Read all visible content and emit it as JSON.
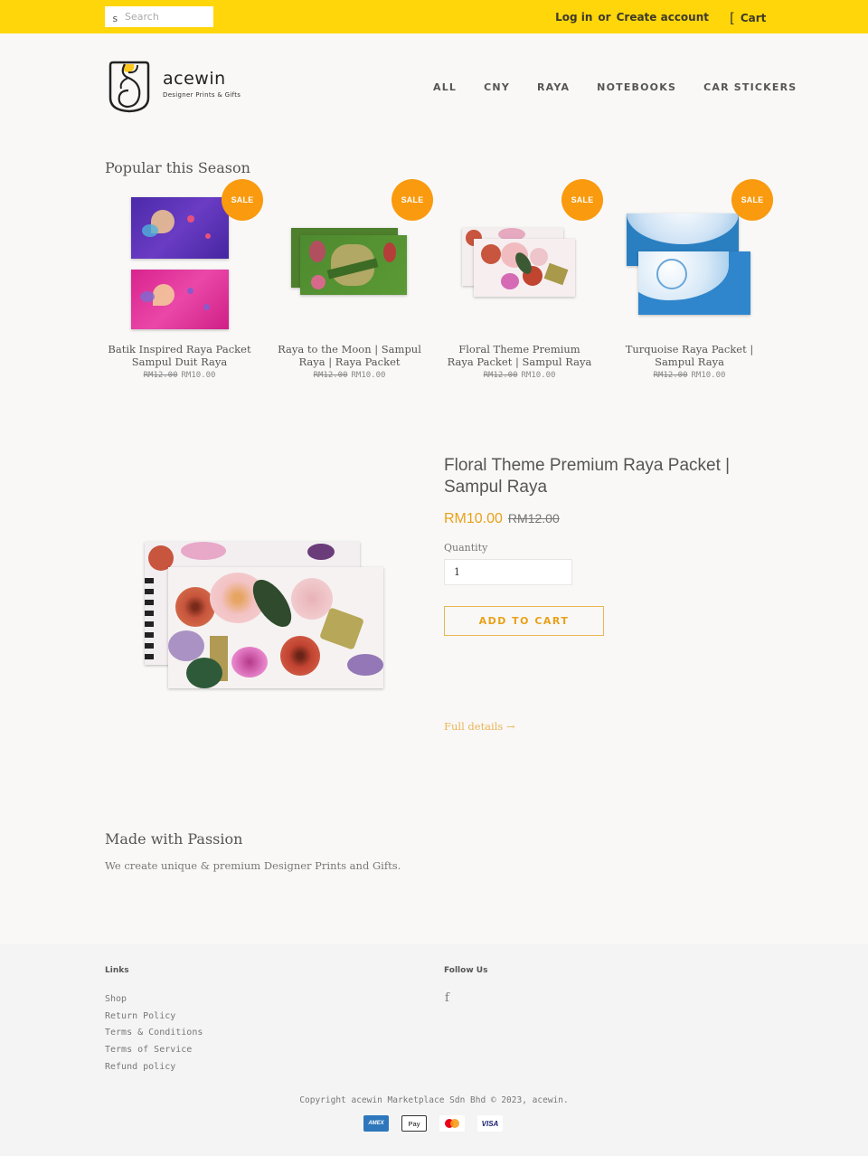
{
  "topbar": {
    "search_icon_glyph": "s",
    "search_placeholder": "Search",
    "login_label": "Log in",
    "or_label": "or",
    "create_account_label": "Create account",
    "cart_icon_glyph": "[",
    "cart_label": "Cart",
    "background_color": "#ffd60a"
  },
  "header": {
    "logo_name": "acewin",
    "logo_tagline": "Designer Prints & Gifts",
    "nav": [
      {
        "label": "ALL"
      },
      {
        "label": "CNY"
      },
      {
        "label": "RAYA"
      },
      {
        "label": "NOTEBOOKS"
      },
      {
        "label": "CAR STICKERS"
      }
    ]
  },
  "popular": {
    "title": "Popular this Season",
    "sale_badge": "SALE",
    "products": [
      {
        "title": "Batik Inspired Raya Packet Sampul Duit Raya",
        "was_price": "RM12.00",
        "price": "RM10.00"
      },
      {
        "title": "Raya to the Moon | Sampul Raya | Raya Packet",
        "was_price": "RM12.00",
        "price": "RM10.00"
      },
      {
        "title": "Floral Theme Premium Raya Packet | Sampul Raya",
        "was_price": "RM12.00",
        "price": "RM10.00"
      },
      {
        "title": "Turquoise Raya Packet | Sampul Raya",
        "was_price": "RM12.00",
        "price": "RM10.00"
      }
    ]
  },
  "featured": {
    "title": "Floral Theme Premium Raya Packet | Sampul Raya",
    "price": "RM10.00",
    "was_price": "RM12.00",
    "quantity_label": "Quantity",
    "quantity_value": "1",
    "add_to_cart_label": "ADD TO CART",
    "full_details_label": "Full details →",
    "accent_color": "#e9a119"
  },
  "passion": {
    "title": "Made with Passion",
    "text": "We create unique & premium Designer Prints and Gifts."
  },
  "footer": {
    "links_heading": "Links",
    "links": [
      {
        "label": "Shop"
      },
      {
        "label": "Return Policy"
      },
      {
        "label": "Terms & Conditions"
      },
      {
        "label": "Terms of Service"
      },
      {
        "label": "Refund policy"
      }
    ],
    "follow_heading": "Follow Us",
    "facebook_glyph": "f",
    "copyright": "Copyright acewin Marketplace Sdn Bhd © 2023, acewin.",
    "payments": [
      {
        "name": "American Express",
        "label": "AMEX"
      },
      {
        "name": "Apple Pay",
        "label": " Pay"
      },
      {
        "name": "Mastercard",
        "label": ""
      },
      {
        "name": "Visa",
        "label": "VISA"
      }
    ]
  }
}
